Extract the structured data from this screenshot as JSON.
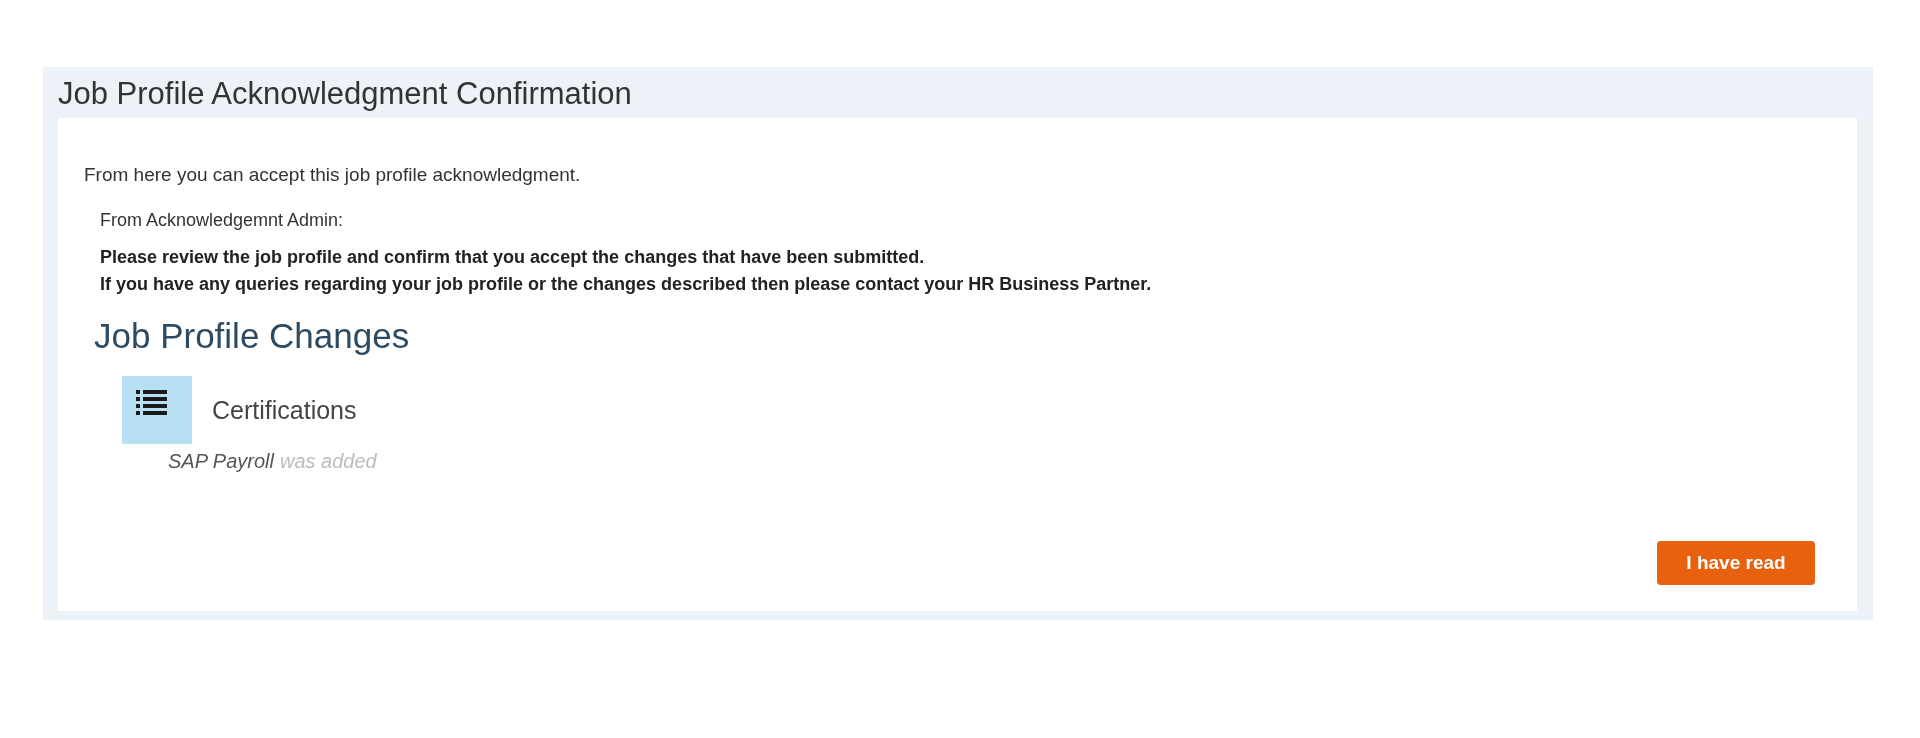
{
  "panel": {
    "title": "Job Profile Acknowledgment Confirmation"
  },
  "intro": "From here you can accept this job profile acknowledgment.",
  "message": {
    "from": "From Acknowledgemnt Admin:",
    "lines": [
      "Please review the job profile and confirm that you accept the changes that have been submitted.",
      "If you have any queries regarding your job profile or the changes described then please contact your HR Business Partner."
    ]
  },
  "changes": {
    "heading": "Job Profile Changes",
    "sections": [
      {
        "title": "Certifications",
        "items": [
          {
            "name": "SAP Payroll",
            "status": "was added"
          }
        ]
      }
    ]
  },
  "buttons": [
    "I have read"
  ]
}
